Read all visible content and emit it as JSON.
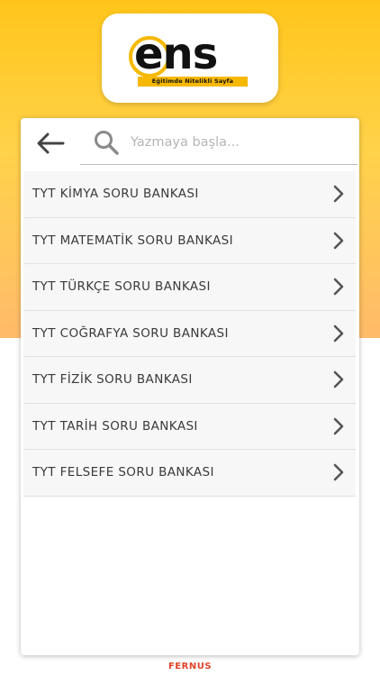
{
  "logo": {
    "wordmark": "ens",
    "tagline": "Eğitimde Nitelikli Sayfa",
    "accent_color": "#f6b800"
  },
  "header": {
    "back_icon": "arrow-left-icon",
    "search_icon": "search-icon",
    "search_placeholder": "Yazmaya başla...",
    "search_value": ""
  },
  "list": {
    "chevron_icon": "chevron-right-icon",
    "items": [
      {
        "label": "TYT KİMYA SORU BANKASI"
      },
      {
        "label": "TYT MATEMATİK SORU BANKASI"
      },
      {
        "label": "TYT TÜRKÇE SORU BANKASI"
      },
      {
        "label": "TYT COĞRAFYA SORU BANKASI"
      },
      {
        "label": "TYT FİZİK SORU BANKASI"
      },
      {
        "label": "TYT TARİH SORU BANKASI"
      },
      {
        "label": "TYT FELSEFE SORU BANKASI"
      }
    ]
  },
  "footer": {
    "brand": "FERNUS",
    "brand_color": "#e0442a"
  },
  "theme": {
    "background_top": "#ffc51a",
    "background_bottom": "#ffffff"
  }
}
